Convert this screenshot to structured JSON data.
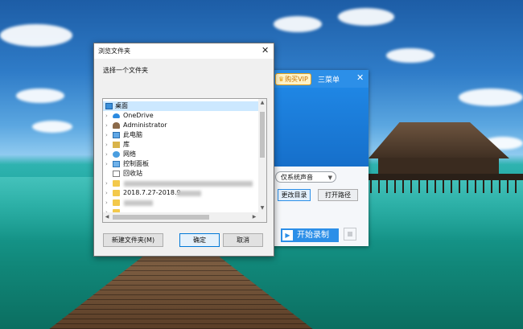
{
  "dialog": {
    "title": "浏览文件夹",
    "instruction": "选择一个文件夹",
    "tree": [
      {
        "label": "桌面",
        "icon": "desktop-icon",
        "selected": true
      },
      {
        "label": "OneDrive",
        "icon": "onedrive-cloud-icon"
      },
      {
        "label": "Administrator",
        "icon": "user-icon"
      },
      {
        "label": "此电脑",
        "icon": "computer-icon"
      },
      {
        "label": "库",
        "icon": "library-icon"
      },
      {
        "label": "网络",
        "icon": "network-icon"
      },
      {
        "label": "控制面板",
        "icon": "control-panel-icon"
      },
      {
        "label": "回收站",
        "icon": "recycle-bin-icon"
      },
      {
        "label": "",
        "icon": "folder-icon"
      },
      {
        "label": "2018.7.27-2018.9",
        "icon": "folder-icon"
      },
      {
        "label": "",
        "icon": "folder-icon"
      },
      {
        "label": "",
        "icon": "folder-icon"
      }
    ],
    "buttons": {
      "new_folder": "新建文件夹(M)",
      "ok": "确定",
      "cancel": "取消"
    },
    "close_glyph": "✕"
  },
  "recorder": {
    "vip_label": "购买VIP",
    "menu_label": "三菜单",
    "close_glyph": "✕",
    "audio_select": "仅系统声音",
    "change_dir_label": "更改目录",
    "open_path_label": "打开路径",
    "start_label": "开始录制",
    "accent_color": "#2c8fe8"
  }
}
